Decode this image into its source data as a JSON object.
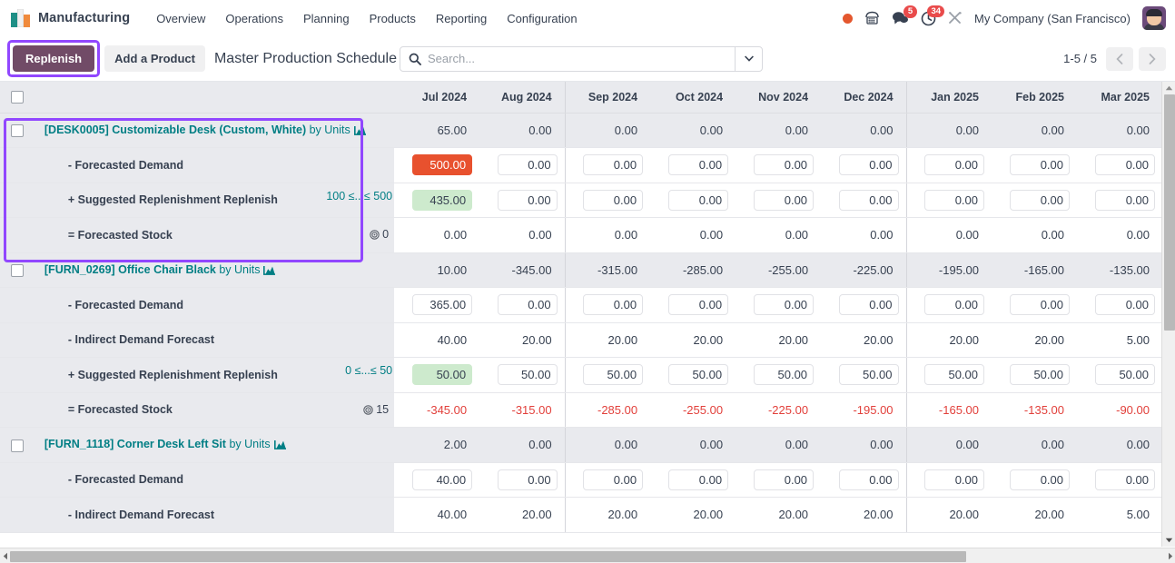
{
  "navbar": {
    "brand": "Manufacturing",
    "menu": [
      "Overview",
      "Operations",
      "Planning",
      "Products",
      "Reporting",
      "Configuration"
    ],
    "icons": {
      "record": "record-dot-icon",
      "phone": "phone-icon",
      "messages": "chat-bubble-icon",
      "activities": "clock-icon",
      "tools": "tools-icon"
    },
    "messages_badge": "5",
    "activities_badge": "34",
    "company": "My Company (San Francisco)",
    "avatar": "user-avatar"
  },
  "control_panel": {
    "replenish_label": "Replenish",
    "add_product_label": "Add a Product",
    "breadcrumb": "Master Production Schedule",
    "search_placeholder": "Search...",
    "search_value": "",
    "pager_count": "1-5 / 5",
    "prev_label": "‹",
    "next_label": "›"
  },
  "table": {
    "columns": [
      "Jul 2024",
      "Aug 2024",
      "Sep 2024",
      "Oct 2024",
      "Nov 2024",
      "Dec 2024",
      "Jan 2025",
      "Feb 2025",
      "Mar 2025"
    ],
    "quarter_separator_after": [
      1,
      5
    ],
    "groups": [
      {
        "selected": true,
        "product_code": "[DESK0005]",
        "product_name": "Customizable Desk (Custom, White)",
        "uom_suffix": "by Units",
        "header_values": [
          "65.00",
          "0.00",
          "0.00",
          "0.00",
          "0.00",
          "0.00",
          "0.00",
          "0.00",
          "0.00"
        ],
        "rows": [
          {
            "label": "- Forecasted Demand",
            "side": "",
            "editable": true,
            "values": [
              "500.00",
              "0.00",
              "0.00",
              "0.00",
              "0.00",
              "0.00",
              "0.00",
              "0.00",
              "0.00"
            ],
            "highlights": [
              "red",
              "",
              "",
              "",
              "",
              "",
              "",
              "",
              ""
            ]
          },
          {
            "label": "+ Suggested Replenishment Replenish",
            "side": "100 ≤...≤ 500",
            "side_style": "range",
            "editable": true,
            "values": [
              "435.00",
              "0.00",
              "0.00",
              "0.00",
              "0.00",
              "0.00",
              "0.00",
              "0.00",
              "0.00"
            ],
            "highlights": [
              "green",
              "",
              "",
              "",
              "",
              "",
              "",
              "",
              ""
            ]
          },
          {
            "label": "= Forecasted Stock",
            "side": "0",
            "side_style": "target",
            "editable": false,
            "values": [
              "0.00",
              "0.00",
              "0.00",
              "0.00",
              "0.00",
              "0.00",
              "0.00",
              "0.00",
              "0.00"
            ],
            "highlights": [
              "",
              "",
              "",
              "",
              "",
              "",
              "",
              "",
              ""
            ]
          }
        ]
      },
      {
        "selected": false,
        "product_code": "[FURN_0269]",
        "product_name": "Office Chair Black",
        "uom_suffix": "by Units",
        "header_values": [
          "10.00",
          "-345.00",
          "-315.00",
          "-285.00",
          "-255.00",
          "-225.00",
          "-195.00",
          "-165.00",
          "-135.00"
        ],
        "rows": [
          {
            "label": "- Forecasted Demand",
            "side": "",
            "editable": true,
            "values": [
              "365.00",
              "0.00",
              "0.00",
              "0.00",
              "0.00",
              "0.00",
              "0.00",
              "0.00",
              "0.00"
            ],
            "highlights": [
              "",
              "",
              "",
              "",
              "",
              "",
              "",
              "",
              ""
            ]
          },
          {
            "label": "- Indirect Demand Forecast",
            "side": "",
            "editable": false,
            "values": [
              "40.00",
              "20.00",
              "20.00",
              "20.00",
              "20.00",
              "20.00",
              "20.00",
              "20.00",
              "5.00"
            ],
            "highlights": [
              "",
              "",
              "",
              "",
              "",
              "",
              "",
              "",
              ""
            ]
          },
          {
            "label": "+ Suggested Replenishment Replenish",
            "side": "0 ≤...≤ 50",
            "side_style": "range",
            "editable": true,
            "values": [
              "50.00",
              "50.00",
              "50.00",
              "50.00",
              "50.00",
              "50.00",
              "50.00",
              "50.00",
              "50.00"
            ],
            "highlights": [
              "green",
              "",
              "",
              "",
              "",
              "",
              "",
              "",
              ""
            ]
          },
          {
            "label": "= Forecasted Stock",
            "side": "15",
            "side_style": "target",
            "editable": false,
            "negative": true,
            "values": [
              "-345.00",
              "-315.00",
              "-285.00",
              "-255.00",
              "-225.00",
              "-195.00",
              "-165.00",
              "-135.00",
              "-90.00"
            ],
            "highlights": [
              "",
              "",
              "",
              "",
              "",
              "",
              "",
              "",
              ""
            ]
          }
        ]
      },
      {
        "selected": false,
        "product_code": "[FURN_1118]",
        "product_name": "Corner Desk Left Sit",
        "uom_suffix": "by Units",
        "header_values": [
          "2.00",
          "0.00",
          "0.00",
          "0.00",
          "0.00",
          "0.00",
          "0.00",
          "0.00",
          "0.00"
        ],
        "rows": [
          {
            "label": "- Forecasted Demand",
            "side": "",
            "editable": true,
            "values": [
              "40.00",
              "0.00",
              "0.00",
              "0.00",
              "0.00",
              "0.00",
              "0.00",
              "0.00",
              "0.00"
            ],
            "highlights": [
              "",
              "",
              "",
              "",
              "",
              "",
              "",
              "",
              ""
            ]
          },
          {
            "label": "- Indirect Demand Forecast",
            "side": "",
            "editable": false,
            "values": [
              "40.00",
              "20.00",
              "20.00",
              "20.00",
              "20.00",
              "20.00",
              "20.00",
              "20.00",
              "5.00"
            ],
            "highlights": [
              "",
              "",
              "",
              "",
              "",
              "",
              "",
              "",
              ""
            ]
          }
        ]
      }
    ]
  }
}
